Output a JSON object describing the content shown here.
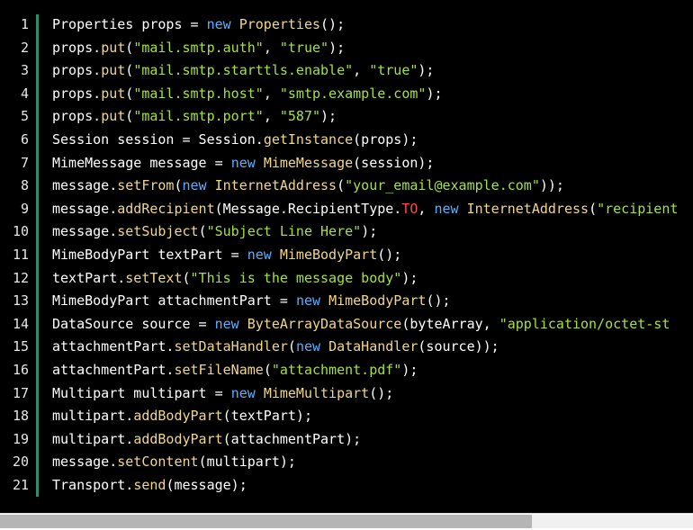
{
  "theme": {
    "background": "#000000",
    "default_text": "#ffffff",
    "keyword": "#5ab0ff",
    "method": "#f1d78a",
    "string": "#a7e23c",
    "constant": "#ff4a4a",
    "gutter_accent": "#2d8f6e"
  },
  "editor": {
    "lines": [
      {
        "number": "1",
        "tokens": [
          {
            "t": "Properties props = ",
            "k": "plain"
          },
          {
            "t": "new",
            "k": "kw"
          },
          {
            "t": " ",
            "k": "plain"
          },
          {
            "t": "Properties",
            "k": "fn"
          },
          {
            "t": "();",
            "k": "plain"
          }
        ]
      },
      {
        "number": "2",
        "tokens": [
          {
            "t": "props.",
            "k": "plain"
          },
          {
            "t": "put",
            "k": "fn"
          },
          {
            "t": "(",
            "k": "plain"
          },
          {
            "t": "\"mail.smtp.auth\"",
            "k": "str"
          },
          {
            "t": ", ",
            "k": "plain"
          },
          {
            "t": "\"true\"",
            "k": "str"
          },
          {
            "t": ");",
            "k": "plain"
          }
        ]
      },
      {
        "number": "3",
        "tokens": [
          {
            "t": "props.",
            "k": "plain"
          },
          {
            "t": "put",
            "k": "fn"
          },
          {
            "t": "(",
            "k": "plain"
          },
          {
            "t": "\"mail.smtp.starttls.enable\"",
            "k": "str"
          },
          {
            "t": ", ",
            "k": "plain"
          },
          {
            "t": "\"true\"",
            "k": "str"
          },
          {
            "t": ");",
            "k": "plain"
          }
        ]
      },
      {
        "number": "4",
        "tokens": [
          {
            "t": "props.",
            "k": "plain"
          },
          {
            "t": "put",
            "k": "fn"
          },
          {
            "t": "(",
            "k": "plain"
          },
          {
            "t": "\"mail.smtp.host\"",
            "k": "str"
          },
          {
            "t": ", ",
            "k": "plain"
          },
          {
            "t": "\"smtp.example.com\"",
            "k": "str"
          },
          {
            "t": ");",
            "k": "plain"
          }
        ]
      },
      {
        "number": "5",
        "tokens": [
          {
            "t": "props.",
            "k": "plain"
          },
          {
            "t": "put",
            "k": "fn"
          },
          {
            "t": "(",
            "k": "plain"
          },
          {
            "t": "\"mail.smtp.port\"",
            "k": "str"
          },
          {
            "t": ", ",
            "k": "plain"
          },
          {
            "t": "\"587\"",
            "k": "str"
          },
          {
            "t": ");",
            "k": "plain"
          }
        ]
      },
      {
        "number": "6",
        "tokens": [
          {
            "t": "Session session = Session.",
            "k": "plain"
          },
          {
            "t": "getInstance",
            "k": "fn"
          },
          {
            "t": "(props);",
            "k": "plain"
          }
        ]
      },
      {
        "number": "7",
        "tokens": [
          {
            "t": "MimeMessage message = ",
            "k": "plain"
          },
          {
            "t": "new",
            "k": "kw"
          },
          {
            "t": " ",
            "k": "plain"
          },
          {
            "t": "MimeMessage",
            "k": "fn"
          },
          {
            "t": "(session);",
            "k": "plain"
          }
        ]
      },
      {
        "number": "8",
        "tokens": [
          {
            "t": "message.",
            "k": "plain"
          },
          {
            "t": "setFrom",
            "k": "fn"
          },
          {
            "t": "(",
            "k": "plain"
          },
          {
            "t": "new",
            "k": "kw"
          },
          {
            "t": " ",
            "k": "plain"
          },
          {
            "t": "InternetAddress",
            "k": "fn"
          },
          {
            "t": "(",
            "k": "plain"
          },
          {
            "t": "\"your_email@example.com\"",
            "k": "str"
          },
          {
            "t": "));",
            "k": "plain"
          }
        ]
      },
      {
        "number": "9",
        "tokens": [
          {
            "t": "message.",
            "k": "plain"
          },
          {
            "t": "addRecipient",
            "k": "fn"
          },
          {
            "t": "(Message.RecipientType.",
            "k": "plain"
          },
          {
            "t": "TO",
            "k": "fld"
          },
          {
            "t": ", ",
            "k": "plain"
          },
          {
            "t": "new",
            "k": "kw"
          },
          {
            "t": " ",
            "k": "plain"
          },
          {
            "t": "InternetAddress",
            "k": "fn"
          },
          {
            "t": "(",
            "k": "plain"
          },
          {
            "t": "\"recipient",
            "k": "str"
          }
        ]
      },
      {
        "number": "10",
        "tokens": [
          {
            "t": "message.",
            "k": "plain"
          },
          {
            "t": "setSubject",
            "k": "fn"
          },
          {
            "t": "(",
            "k": "plain"
          },
          {
            "t": "\"Subject Line Here\"",
            "k": "str"
          },
          {
            "t": ");",
            "k": "plain"
          }
        ]
      },
      {
        "number": "11",
        "tokens": [
          {
            "t": "MimeBodyPart textPart = ",
            "k": "plain"
          },
          {
            "t": "new",
            "k": "kw"
          },
          {
            "t": " ",
            "k": "plain"
          },
          {
            "t": "MimeBodyPart",
            "k": "fn"
          },
          {
            "t": "();",
            "k": "plain"
          }
        ]
      },
      {
        "number": "12",
        "tokens": [
          {
            "t": "textPart.",
            "k": "plain"
          },
          {
            "t": "setText",
            "k": "fn"
          },
          {
            "t": "(",
            "k": "plain"
          },
          {
            "t": "\"This is the message body\"",
            "k": "str"
          },
          {
            "t": ");",
            "k": "plain"
          }
        ]
      },
      {
        "number": "13",
        "tokens": [
          {
            "t": "MimeBodyPart attachmentPart = ",
            "k": "plain"
          },
          {
            "t": "new",
            "k": "kw"
          },
          {
            "t": " ",
            "k": "plain"
          },
          {
            "t": "MimeBodyPart",
            "k": "fn"
          },
          {
            "t": "();",
            "k": "plain"
          }
        ]
      },
      {
        "number": "14",
        "tokens": [
          {
            "t": "DataSource source = ",
            "k": "plain"
          },
          {
            "t": "new",
            "k": "kw"
          },
          {
            "t": " ",
            "k": "plain"
          },
          {
            "t": "ByteArrayDataSource",
            "k": "fn"
          },
          {
            "t": "(byteArray, ",
            "k": "plain"
          },
          {
            "t": "\"application/octet-st",
            "k": "str"
          }
        ]
      },
      {
        "number": "15",
        "tokens": [
          {
            "t": "attachmentPart.",
            "k": "plain"
          },
          {
            "t": "setDataHandler",
            "k": "fn"
          },
          {
            "t": "(",
            "k": "plain"
          },
          {
            "t": "new",
            "k": "kw"
          },
          {
            "t": " ",
            "k": "plain"
          },
          {
            "t": "DataHandler",
            "k": "fn"
          },
          {
            "t": "(source));",
            "k": "plain"
          }
        ]
      },
      {
        "number": "16",
        "tokens": [
          {
            "t": "attachmentPart.",
            "k": "plain"
          },
          {
            "t": "setFileName",
            "k": "fn"
          },
          {
            "t": "(",
            "k": "plain"
          },
          {
            "t": "\"attachment.pdf\"",
            "k": "str"
          },
          {
            "t": ");",
            "k": "plain"
          }
        ]
      },
      {
        "number": "17",
        "tokens": [
          {
            "t": "Multipart multipart = ",
            "k": "plain"
          },
          {
            "t": "new",
            "k": "kw"
          },
          {
            "t": " ",
            "k": "plain"
          },
          {
            "t": "MimeMultipart",
            "k": "fn"
          },
          {
            "t": "();",
            "k": "plain"
          }
        ]
      },
      {
        "number": "18",
        "tokens": [
          {
            "t": "multipart.",
            "k": "plain"
          },
          {
            "t": "addBodyPart",
            "k": "fn"
          },
          {
            "t": "(textPart);",
            "k": "plain"
          }
        ]
      },
      {
        "number": "19",
        "tokens": [
          {
            "t": "multipart.",
            "k": "plain"
          },
          {
            "t": "addBodyPart",
            "k": "fn"
          },
          {
            "t": "(attachmentPart);",
            "k": "plain"
          }
        ]
      },
      {
        "number": "20",
        "tokens": [
          {
            "t": "message.",
            "k": "plain"
          },
          {
            "t": "setContent",
            "k": "fn"
          },
          {
            "t": "(multipart);",
            "k": "plain"
          }
        ]
      },
      {
        "number": "21",
        "tokens": [
          {
            "t": "Transport.",
            "k": "plain"
          },
          {
            "t": "send",
            "k": "fn"
          },
          {
            "t": "(message);",
            "k": "plain"
          }
        ]
      }
    ]
  },
  "scrollbar": {
    "horizontal_position": 0.0
  }
}
